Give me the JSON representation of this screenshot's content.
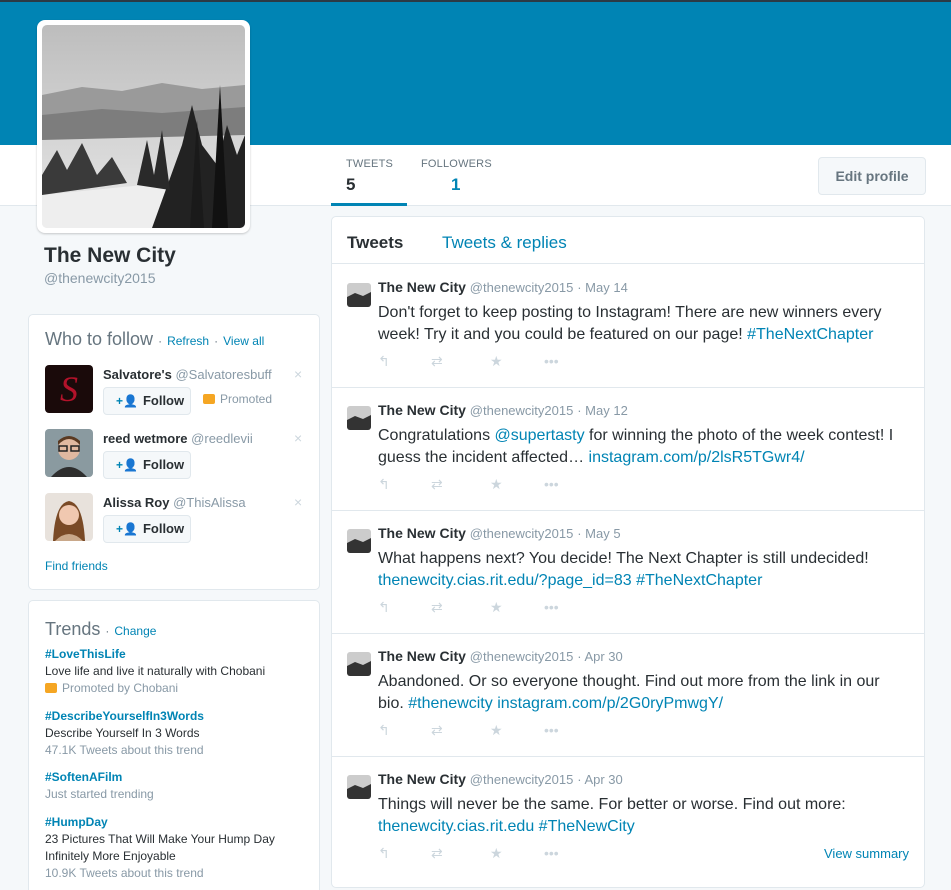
{
  "colors": {
    "brand": "#0084b4",
    "text": "#292f33",
    "muted": "#8899a6",
    "background": "#f5f8fa"
  },
  "profile": {
    "name": "The New City",
    "handle": "@thenewcity2015"
  },
  "stats": {
    "tweets_label": "TWEETS",
    "tweets_value": "5",
    "followers_label": "FOLLOWERS",
    "followers_value": "1"
  },
  "edit_profile_label": "Edit profile",
  "who_to_follow": {
    "title": "Who to follow",
    "sep": "·",
    "refresh": "Refresh",
    "view_all": "View all",
    "find_friends": "Find friends",
    "close_glyph": "×",
    "follow_label": "Follow",
    "follow_icon": "+👤",
    "suggestions": [
      {
        "name": "Salvatore's",
        "handle": "@Salvatoresbuff",
        "promoted": "Promoted"
      },
      {
        "name": "reed wetmore",
        "handle": "@reedlevii",
        "promoted": ""
      },
      {
        "name": "Alissa Roy",
        "handle": "@ThisAlissa",
        "promoted": ""
      }
    ]
  },
  "trends": {
    "title": "Trends",
    "sep": "·",
    "change": "Change",
    "items": [
      {
        "name": "#LoveThisLife",
        "desc": "Love life and live it naturally with Chobani",
        "meta": "Promoted by Chobani"
      },
      {
        "name": "#DescribeYourselfIn3Words",
        "desc": "Describe Yourself In 3 Words",
        "meta": "47.1K Tweets about this trend"
      },
      {
        "name": "#SoftenAFilm",
        "desc": "",
        "meta": "Just started trending"
      },
      {
        "name": "#HumpDay",
        "desc": "23 Pictures That Will Make Your Hump Day",
        "desc2": "Infinitely More Enjoyable",
        "meta": "10.9K Tweets about this trend"
      }
    ]
  },
  "timeline": {
    "tab_tweets": "Tweets",
    "tab_replies": "Tweets & replies",
    "view_summary": "View summary",
    "action_icons": [
      "reply-icon",
      "retweet-icon",
      "favorite-icon",
      "more-icon"
    ],
    "tweets": [
      {
        "name": "The New City",
        "handle": "@thenewcity2015",
        "date": "· May 14",
        "line1": "Don't forget to keep posting to Instagram! There are new winners every",
        "line2_text": "week! Try it and you could be featured on our page! ",
        "line2_link": "#TheNextChapter"
      },
      {
        "name": "The New City",
        "handle": "@thenewcity2015",
        "date": "· May 12",
        "line1_a": "Congratulations ",
        "line1_link": "@supertasty",
        "line1_b": " for winning the photo of the week contest! I",
        "line2_text": "guess the incident affected… ",
        "line2_link": "instagram.com/p/2lsR5TGwr4/"
      },
      {
        "name": "The New City",
        "handle": "@thenewcity2015",
        "date": "· May 5",
        "line1": "What happens next? You decide! The Next Chapter is still undecided!",
        "line2_link": "thenewcity.cias.rit.edu/?page_id=83",
        "line2_link2": "#TheNextChapter"
      },
      {
        "name": "The New City",
        "handle": "@thenewcity2015",
        "date": "· Apr 30",
        "line1": "Abandoned. Or so everyone thought. Find out more from the link in our",
        "line2_text": "bio. ",
        "line2_link": "#thenewcity",
        "line2_link2": "instagram.com/p/2G0ryPmwgY/"
      },
      {
        "name": "The New City",
        "handle": "@thenewcity2015",
        "date": "· Apr 30",
        "line1": "Things will never be the same. For better or worse. Find out more:",
        "line2_link": "thenewcity.cias.rit.edu",
        "line2_link2": "#TheNewCity"
      }
    ]
  }
}
